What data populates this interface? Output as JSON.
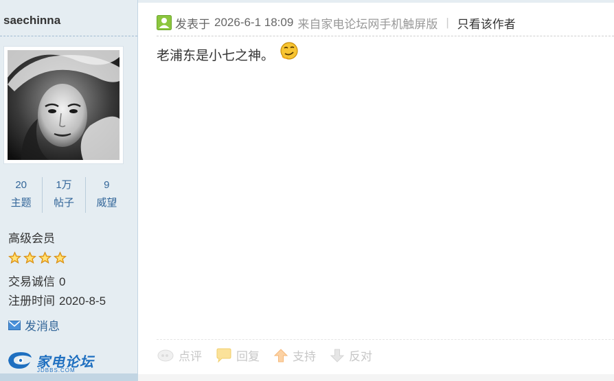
{
  "user": {
    "username": "saechinna",
    "avatar_alt": "",
    "stats": [
      {
        "value": "20",
        "label": "主题"
      },
      {
        "value": "1万",
        "label": "帖子"
      },
      {
        "value": "9",
        "label": "威望"
      }
    ],
    "rank": "高级会员",
    "stars": 4,
    "trade_label": "交易诚信",
    "trade_value": "0",
    "register_label": "注册时间",
    "register_value": "2020-8-5",
    "send_message": "发消息"
  },
  "logo": {
    "text": "家电论坛",
    "sub": "JDBBS.COM"
  },
  "post": {
    "posted_label": "发表于",
    "posted_time": "2026-6-1 18:09",
    "source": "来自家电论坛网手机触屏版",
    "separator": "|",
    "only_author": "只看该作者",
    "content": "老浦东是小七之神。",
    "emoji_icon": "smirk-emoji-icon"
  },
  "actions": [
    {
      "label": "点评",
      "icon": "comment-icon"
    },
    {
      "label": "回复",
      "icon": "reply-icon"
    },
    {
      "label": "支持",
      "icon": "thumb-up-arrow-icon"
    },
    {
      "label": "反对",
      "icon": "thumb-down-arrow-icon"
    }
  ],
  "colors": {
    "sidebar_bg": "#e5edf2",
    "link_blue": "#336699",
    "star_gold": "#f5b52e",
    "muted_action": "#c7c7c7"
  }
}
